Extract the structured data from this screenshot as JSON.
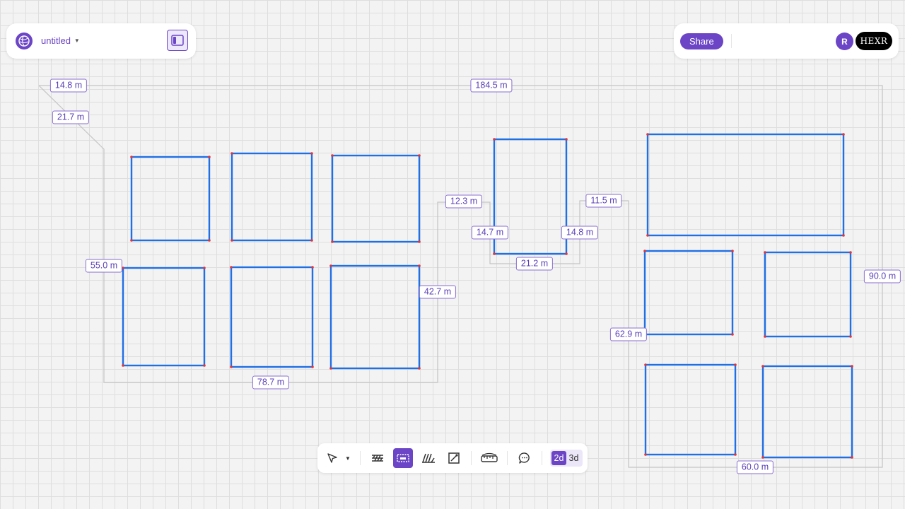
{
  "header": {
    "doc_title": "untitled",
    "share_label": "Share",
    "avatar_initial": "R",
    "brand_label": "HEXR"
  },
  "colors": {
    "accent": "#6b45c6",
    "room_outline": "#1f6fe5",
    "vertex": "#e0353b",
    "dimension_line": "#c4c4c4"
  },
  "dimensions": [
    "14.8 m",
    "184.5 m",
    "21.7 m",
    "12.3 m",
    "11.5 m",
    "14.7 m",
    "14.8 m",
    "21.2 m",
    "55.0 m",
    "42.7 m",
    "90.0 m",
    "62.9 m",
    "78.7 m",
    "60.0 m"
  ],
  "toolbar": {
    "tools": [
      {
        "name": "select-tool",
        "icon": "pointer-icon"
      },
      {
        "name": "select-dropdown",
        "icon": "chevron-down-icon"
      },
      {
        "name": "wall-tool",
        "icon": "wall-icon"
      },
      {
        "name": "room-tool",
        "icon": "room-icon"
      },
      {
        "name": "stairs-tool",
        "icon": "stairs-icon"
      },
      {
        "name": "area-tool",
        "icon": "area-icon"
      },
      {
        "name": "measure-tool",
        "icon": "ruler-icon"
      },
      {
        "name": "comment-tool",
        "icon": "comment-icon"
      }
    ],
    "active_tool": "room-tool",
    "view_2d": "2d",
    "view_3d": "3d",
    "active_view": "2d"
  }
}
